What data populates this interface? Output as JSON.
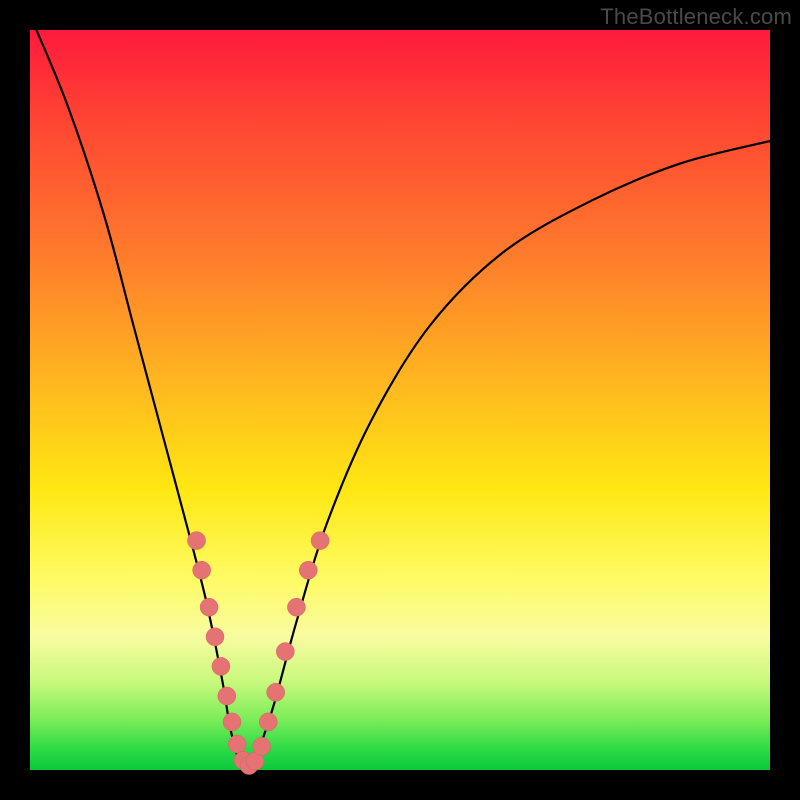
{
  "watermark": "TheBottleneck.com",
  "colors": {
    "curve_stroke": "#000000",
    "marker_fill": "#e57373",
    "marker_stroke": "#d66262"
  },
  "chart_data": {
    "type": "line",
    "title": "",
    "xlabel": "",
    "ylabel": "",
    "xlim": [
      0,
      100
    ],
    "ylim": [
      0,
      100
    ],
    "series": [
      {
        "name": "bottleneck-curve",
        "x": [
          0,
          5,
          10,
          14,
          18,
          22,
          24,
          26,
          27,
          28,
          29,
          30,
          31,
          33,
          36,
          40,
          46,
          54,
          64,
          76,
          88,
          100
        ],
        "y": [
          102,
          90,
          75,
          60,
          45,
          30,
          22,
          12,
          6,
          2,
          0.5,
          1,
          3,
          9,
          20,
          33,
          47,
          60,
          70,
          77,
          82,
          85
        ]
      }
    ],
    "markers": [
      {
        "x": 22.5,
        "y": 31
      },
      {
        "x": 23.2,
        "y": 27
      },
      {
        "x": 24.2,
        "y": 22
      },
      {
        "x": 25.0,
        "y": 18
      },
      {
        "x": 25.8,
        "y": 14
      },
      {
        "x": 26.6,
        "y": 10
      },
      {
        "x": 27.3,
        "y": 6.5
      },
      {
        "x": 28.0,
        "y": 3.5
      },
      {
        "x": 28.8,
        "y": 1.3
      },
      {
        "x": 29.6,
        "y": 0.6
      },
      {
        "x": 30.4,
        "y": 1.2
      },
      {
        "x": 31.3,
        "y": 3.2
      },
      {
        "x": 32.2,
        "y": 6.5
      },
      {
        "x": 33.2,
        "y": 10.5
      },
      {
        "x": 34.5,
        "y": 16
      },
      {
        "x": 36.0,
        "y": 22
      },
      {
        "x": 37.6,
        "y": 27
      },
      {
        "x": 39.2,
        "y": 31
      }
    ]
  }
}
